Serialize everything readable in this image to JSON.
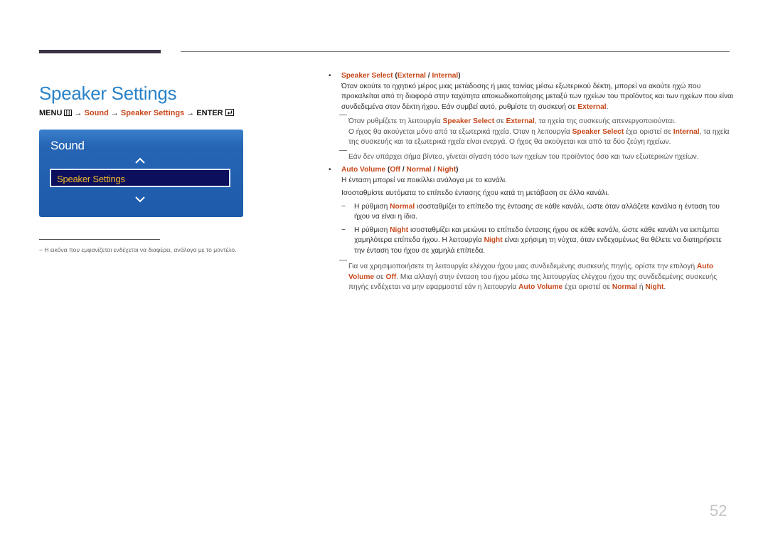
{
  "page": {
    "title": "Speaker Settings",
    "number": "52"
  },
  "menu_path": {
    "menu": "MENU",
    "arrow": "→",
    "sound": "Sound",
    "speaker_settings": "Speaker Settings",
    "enter": "ENTER",
    "menu_icon": "menu-grid-icon",
    "enter_icon": "enter-icon"
  },
  "osd": {
    "title": "Sound",
    "selected_item": "Speaker Settings",
    "up_icon": "chevron-up-icon",
    "down_icon": "chevron-down-icon"
  },
  "footnote": {
    "dash": "−",
    "text": "Η εικόνα που εμφανίζεται ενδέχεται να διαφέρει, ανάλογα με το μοντέλο."
  },
  "colors": {
    "title_blue": "#2a82c8",
    "highlight": "#c8471a",
    "osd_blue": "#1e5aaa",
    "osd_selected_bg": "#0c0f5c",
    "osd_selected_text": "#f1b928"
  },
  "content": {
    "speaker_select": {
      "name": "Speaker Select",
      "opt1": "External",
      "opt2": "Internal",
      "desc_a": "Όταν ακούτε το ηχητικό μέρος μιας μετάδοσης ή μιας ταινίας μέσω εξωτερικού δέκτη, μπορεί να ακούτε ηχώ που προκαλείται από τη διαφορά στην ταχύτητα αποκωδικοποίησης μεταξύ των ηχείων του προϊόντος και των ηχείων που είναι συνδεδεμένα στον δέκτη ήχου. Εάν συμβεί αυτό, ρυθμίστε τη συσκευή σε ",
      "desc_b": "External",
      "desc_c": ".",
      "note1_a": "Όταν ρυθμίζετε τη λειτουργία ",
      "note1_b": "Speaker Select",
      "note1_c": " σε ",
      "note1_d": "External",
      "note1_e": ", τα ηχεία της συσκευής απενεργοποιούνται.",
      "note1_f": "Ο ήχος θα ακούγεται μόνο από τα εξωτερικά ηχεία. Όταν η λειτουργία ",
      "note1_g": "Speaker Select",
      "note1_h": " έχει οριστεί σε ",
      "note1_i": "Internal",
      "note1_j": ", τα ηχεία της συσκευής και τα εξωτερικά ηχεία είναι ενεργά. Ο ήχος θα ακούγεται και από τα δύο ζεύγη ηχείων.",
      "note2": "Εάν δεν υπάρχει σήμα βίντεο, γίνεται σίγαση τόσο των ηχείων του προϊόντος όσο και των εξωτερικών ηχείων."
    },
    "auto_volume": {
      "name": "Auto Volume",
      "opt1": "Off",
      "opt2": "Normal",
      "opt3": "Night",
      "desc1": "Η ένταση μπορεί να ποικίλλει ανάλογα με το κανάλι.",
      "desc2": "Ισοσταθμίστε αυτόματα το επίπεδο έντασης ήχου κατά τη μετάβαση σε άλλο κανάλι.",
      "sub1_a": "Η ρύθμιση ",
      "sub1_b": "Normal",
      "sub1_c": " ισοσταθμίζει το επίπεδο της έντασης σε κάθε κανάλι, ώστε όταν αλλάζετε κανάλια η ένταση του ήχου να είναι η ίδια.",
      "sub2_a": "Η ρύθμιση ",
      "sub2_b": "Night",
      "sub2_c": " ισοσταθμίζει και μειώνει το επίπεδο έντασης ήχου σε κάθε κανάλι, ώστε κάθε κανάλι να εκπέμπει χαμηλότερα επίπεδα ήχου. Η λειτουργία ",
      "sub2_d": "Night",
      "sub2_e": " είναι χρήσιμη τη νύχτα, όταν ενδεχομένως θα θέλετε να διατηρήσετε την ένταση του ήχου σε χαμηλά επίπεδα.",
      "note_a": "Για να χρησιμοποιήσετε τη λειτουργία ελέγχου ήχου μιας συνδεδεμένης συσκευής πηγής, ορίστε την επιλογή ",
      "note_b": "Auto Volume",
      "note_c": " σε ",
      "note_d": "Off",
      "note_e": ". Μια αλλαγή στην ένταση του ήχου μέσω της λειτουργίας ελέγχου ήχου της συνδεδεμένης συσκευής πηγής ενδέχεται να μην εφαρμοστεί εάν η λειτουργία ",
      "note_f": "Auto Volume",
      "note_g": " έχει οριστεί σε ",
      "note_h": "Normal",
      "note_i": " ή ",
      "note_j": "Night",
      "note_k": "."
    },
    "bullet": "•",
    "minus": "−",
    "slash": " / ",
    "lparen": " (",
    "rparen": ")"
  }
}
